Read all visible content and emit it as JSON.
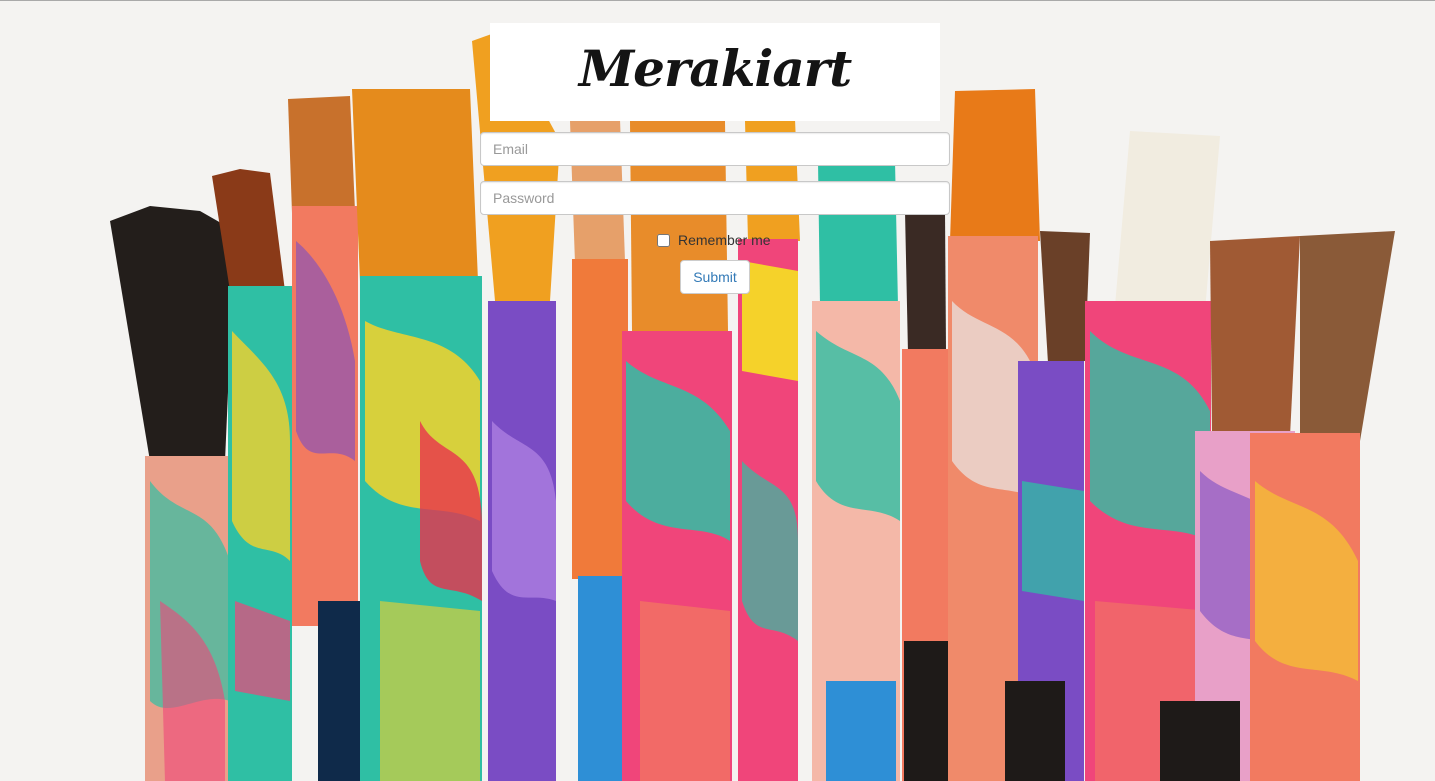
{
  "brand": {
    "logo_text": "Merakiart"
  },
  "login_form": {
    "email_placeholder": "Email",
    "password_placeholder": "Password",
    "remember_label": "Remember me",
    "remember_checked": false,
    "submit_label": "Submit",
    "submit_color": "#337ab7"
  },
  "background": {
    "subject": "paint-brushes",
    "colors": [
      "#1d1a17",
      "#2fbfa4",
      "#f0457a",
      "#7a4cc4",
      "#f5d22a",
      "#ff8a2a",
      "#2e8fd6",
      "#e8e8e8"
    ]
  }
}
